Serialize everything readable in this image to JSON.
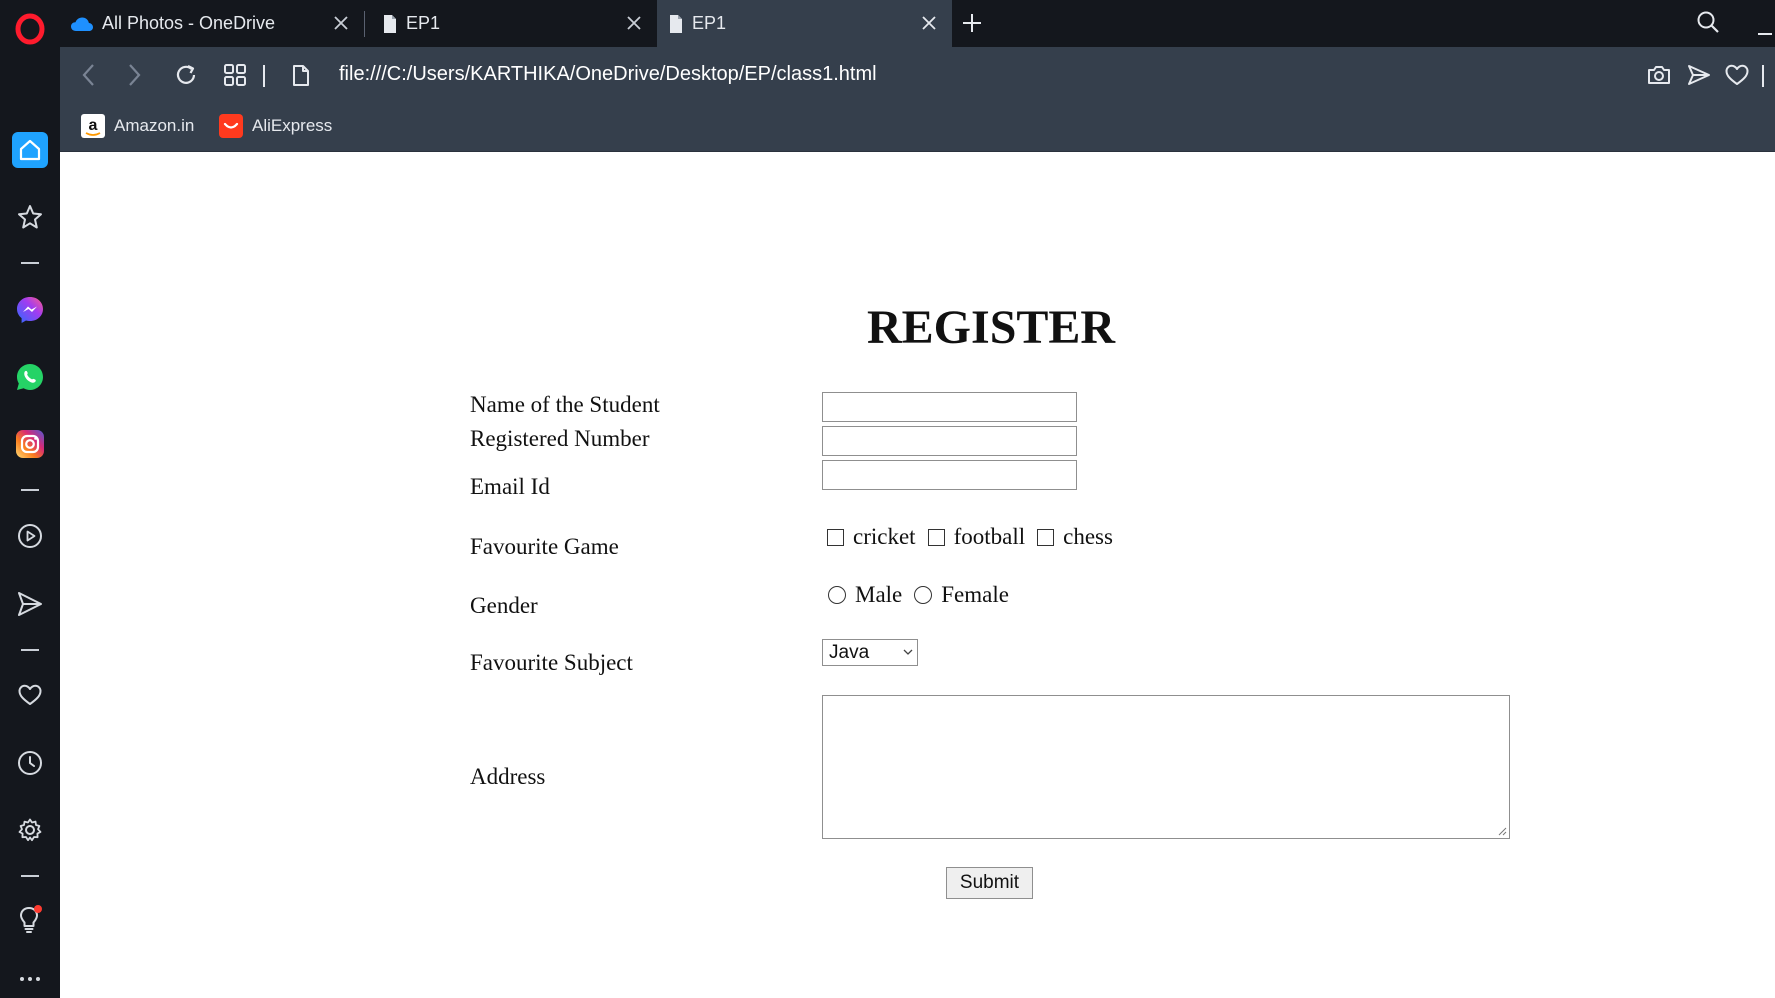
{
  "browser": {
    "tabs": [
      {
        "title": "All Photos - OneDrive",
        "active": false
      },
      {
        "title": "EP1",
        "active": false
      },
      {
        "title": "EP1",
        "active": true
      }
    ],
    "url": "file:///C:/Users/KARTHIKA/OneDrive/Desktop/EP/class1.html",
    "bookmarks": [
      {
        "label": "Amazon.in",
        "icon": "amazon-icon"
      },
      {
        "label": "AliExpress",
        "icon": "aliexpress-icon"
      }
    ],
    "sidebar_icons": [
      "opera-logo",
      "home-icon",
      "star-icon",
      "messenger-icon",
      "whatsapp-icon",
      "instagram-icon",
      "player-icon",
      "send-icon",
      "heart-icon",
      "history-icon",
      "settings-icon",
      "lightbulb-icon",
      "more-icon"
    ],
    "colors": {
      "sidebar_bg": "#14171d",
      "toolbar_bg": "#353f4c",
      "accent": "#1fa3ff",
      "opera_red": "#ff1b2d"
    }
  },
  "form": {
    "title": "REGISTER",
    "fields": {
      "name_label": "Name of the Student",
      "regno_label": "Registered Number",
      "email_label": "Email Id",
      "game_label": "Favourite Game",
      "gender_label": "Gender",
      "subject_label": "Favourite Subject",
      "address_label": "Address"
    },
    "games": [
      "cricket",
      "football",
      "chess"
    ],
    "genders": [
      "Male",
      "Female"
    ],
    "subject_selected": "Java",
    "submit_label": "Submit"
  }
}
